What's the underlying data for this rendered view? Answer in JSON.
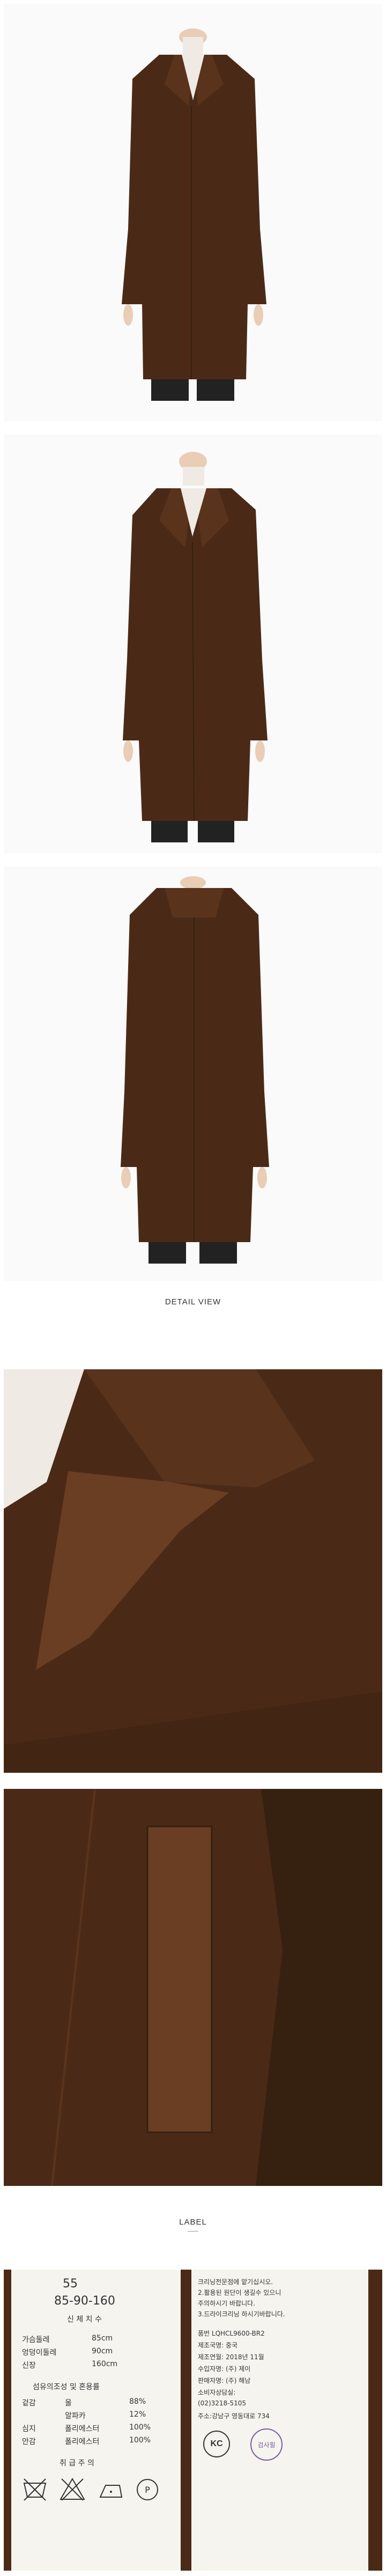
{
  "sections": {
    "detail_view": "DETAIL VIEW",
    "label": "LABEL"
  },
  "size_label": {
    "size_code": "55",
    "body_measure": "85-90-160",
    "body_measure_caption": "신 체 치 수",
    "rows": [
      {
        "name": "가슴둘레",
        "value": "85cm"
      },
      {
        "name": "엉덩이둘레",
        "value": "90cm"
      },
      {
        "name": "신장",
        "value": "160cm"
      }
    ],
    "composition_title": "섬유의조성 및 혼용률",
    "composition": [
      {
        "part": "겉감",
        "material": "울",
        "pct": "88%"
      },
      {
        "part": "",
        "material": "알파카",
        "pct": "12%"
      },
      {
        "part": "심지",
        "material": "폴리에스터",
        "pct": "100%"
      },
      {
        "part": "안감",
        "material": "폴리에스터",
        "pct": "100%"
      }
    ],
    "care_title": "취 급 주 의"
  },
  "info_label": {
    "lines": [
      "크리닝전문점에 맡기십시오.",
      "2.활용된 원단이 생길수 있으니",
      "주의하시기 바랍니다.",
      "3.드라이크리닝 하시기바랍니다."
    ],
    "product_line": "품번 LQHCL9600-BR2",
    "origin": "제조국명: 중국",
    "date": "제조연월: 2018년 11월",
    "importer": "수입자명: (주) 제이",
    "seller": "판매자명: (주) 해남",
    "cs_title": "소비자상담실:",
    "phone": "(02)3218-5105",
    "address": "주소:강남구 영동대로 734",
    "kc_mark": "KC",
    "stamp_text": "검사필"
  },
  "colors": {
    "coat": "#4a2a17",
    "coat_dark": "#36200f",
    "coat_light": "#6a3e22",
    "skin": "#e9cdb5",
    "sweater": "#efeae3"
  }
}
